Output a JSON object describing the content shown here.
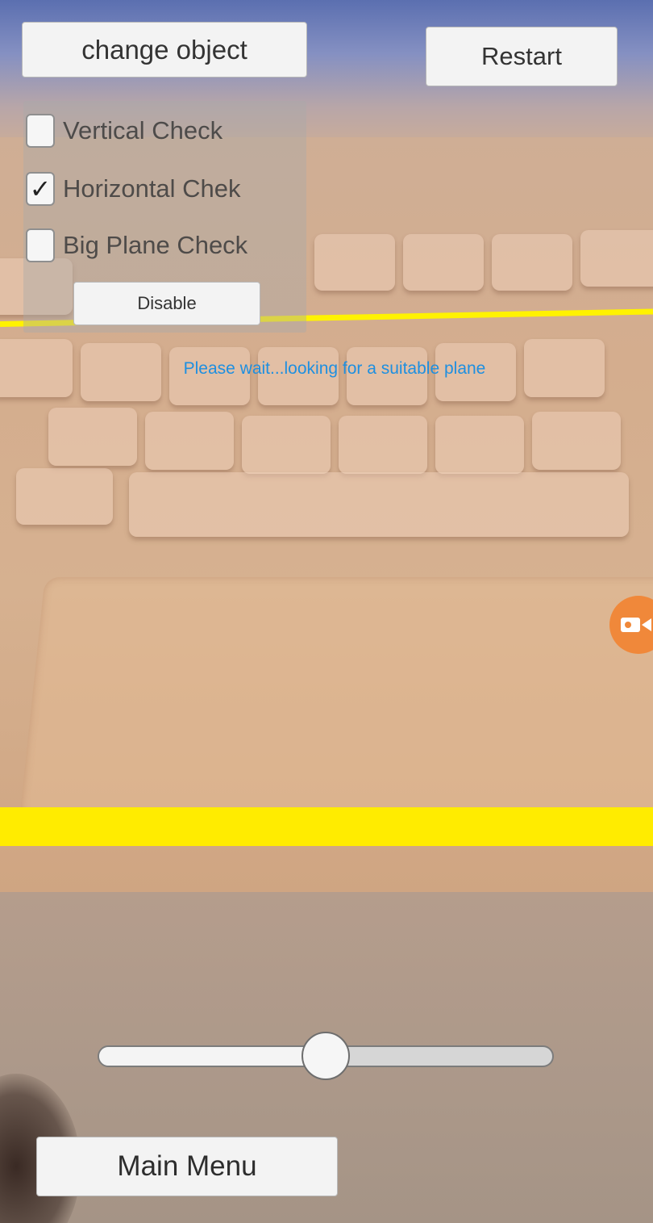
{
  "toolbar": {
    "change_object_label": "change object",
    "restart_label": "Restart"
  },
  "detection_panel": {
    "options": [
      {
        "label": "Vertical Check",
        "checked": false
      },
      {
        "label": "Horizontal Chek",
        "checked": true
      },
      {
        "label": "Big Plane Check",
        "checked": false
      }
    ],
    "disable_label": "Disable"
  },
  "status": {
    "message": "Please wait...looking for a suitable plane",
    "color": "#1e8fe0"
  },
  "record_button": {
    "icon": "video-camera-icon",
    "color": "#f0883a"
  },
  "slider": {
    "value_fraction": 0.5
  },
  "footer": {
    "main_menu_label": "Main Menu"
  },
  "overlay": {
    "plane_line_color": "#fff200",
    "plane_band_color": "#ffec00"
  }
}
